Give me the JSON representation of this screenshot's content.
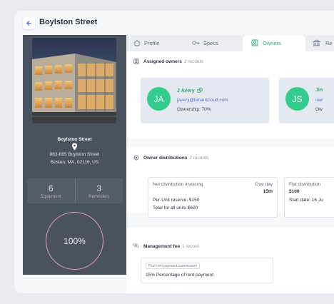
{
  "header": {
    "title": "Boylston Street"
  },
  "sidebar": {
    "name": "Boylston Street",
    "address_line1": "883-885 Boylston Street",
    "address_line2": "Boston, MA, 02116, US",
    "stats": [
      {
        "value": "6",
        "label": "Equipment"
      },
      {
        "value": "3",
        "label": "Reminders"
      }
    ],
    "progress_label": "100%",
    "progress_value": 1.0
  },
  "tabs": [
    {
      "label": "Profile",
      "icon": "house-icon"
    },
    {
      "label": "Specs",
      "icon": "key-icon"
    },
    {
      "label": "Owners",
      "icon": "owner-icon",
      "active": true
    },
    {
      "label": "Re",
      "icon": "building-icon"
    }
  ],
  "owners_section": {
    "title": "Assigned owners",
    "count": "2 records",
    "owners": [
      {
        "initials": "JA",
        "name": "J Avery",
        "email": "javery@tenantcloud.com",
        "ownership": "Ownership: 70%"
      },
      {
        "initials": "JS",
        "name": "Jin",
        "email": "owr",
        "ownership": "Ow"
      }
    ]
  },
  "distributions_section": {
    "title": "Owner distributions",
    "count": "2 records",
    "cards": [
      {
        "title": "Net distribution invoicing",
        "due_label": "Due day",
        "due_value": "15th",
        "line1": "Per-Unit reserve: $150",
        "line2": "Total for all units $600"
      },
      {
        "title": "Flat distribution",
        "value": "$100",
        "start": "Start date: 16 Ju"
      }
    ]
  },
  "fee_section": {
    "title": "Management fee",
    "count": "1 record",
    "chip": "First rent payment commission",
    "value": "15% Percentage of rent payment"
  },
  "colors": {
    "accent": "#2ba872",
    "sidebar": "#49525f",
    "avatar": "#33cc8c",
    "ring": "#e79ab9",
    "link": "#5a6bd6"
  }
}
